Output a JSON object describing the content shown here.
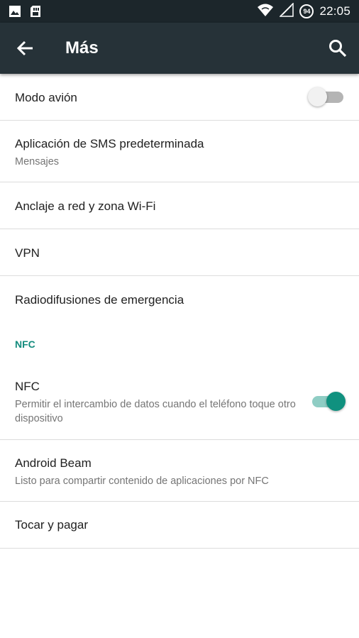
{
  "status_bar": {
    "time": "22:05",
    "battery": "94",
    "icons": [
      "image-icon",
      "sd-card-icon",
      "wifi-icon",
      "signal-icon",
      "battery-icon"
    ]
  },
  "toolbar": {
    "title": "Más",
    "back_icon": "arrow-left-icon",
    "search_icon": "search-icon"
  },
  "items": [
    {
      "primary": "Modo avión",
      "switch": "off"
    },
    {
      "primary": "Aplicación de SMS predeterminada",
      "secondary": "Mensajes"
    },
    {
      "primary": "Anclaje a red y zona Wi-Fi"
    },
    {
      "primary": "VPN"
    },
    {
      "primary": "Radiodifusiones de emergencia"
    }
  ],
  "nfc_section": {
    "header": "NFC",
    "items": [
      {
        "primary": "NFC",
        "secondary": "Permitir el intercambio de datos cuando el teléfono toque otro dispositivo",
        "switch": "on"
      },
      {
        "primary": "Android Beam",
        "secondary": "Listo para compartir contenido de aplicaciones por NFC"
      },
      {
        "primary": "Tocar y pagar"
      }
    ]
  },
  "colors": {
    "status_bar": "#1c262b",
    "toolbar": "#263238",
    "accent": "#138b7d",
    "switch_on_thumb": "#10917f",
    "switch_on_track": "#8fcdc4"
  }
}
